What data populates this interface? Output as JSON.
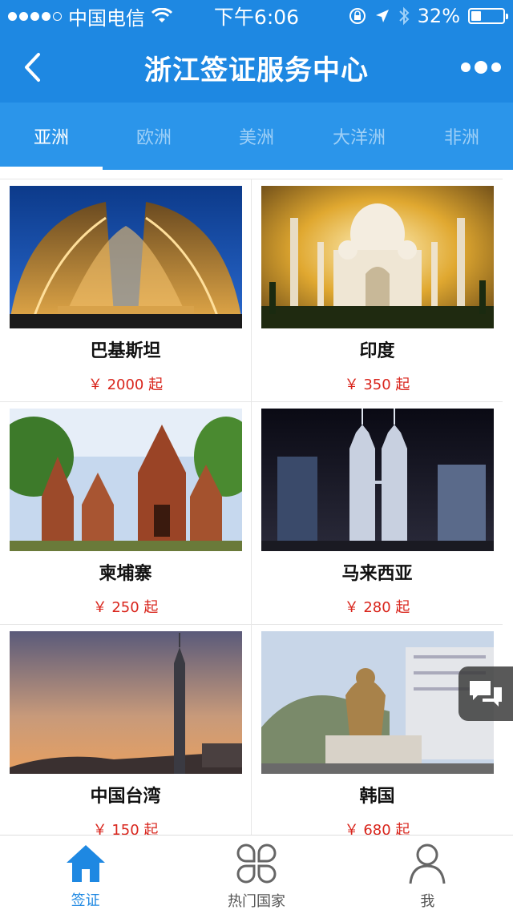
{
  "status": {
    "carrier": "中国电信",
    "time": "下午6:06",
    "battery": "32%",
    "battery_level": 0.32
  },
  "nav": {
    "title": "浙江签证服务中心",
    "back_icon": "chevron-left-icon",
    "more_icon": "more-dots-icon"
  },
  "tabs": [
    {
      "label": "亚洲",
      "active": true
    },
    {
      "label": "欧洲",
      "active": false
    },
    {
      "label": "美洲",
      "active": false
    },
    {
      "label": "大洋洲",
      "active": false
    },
    {
      "label": "非洲",
      "active": false
    }
  ],
  "countries": [
    {
      "name": "巴基斯坦",
      "price": "￥ 2000 起",
      "image": "pakistan-monument-image"
    },
    {
      "name": "印度",
      "price": "￥ 350 起",
      "image": "taj-mahal-image"
    },
    {
      "name": "柬埔寨",
      "price": "￥ 250 起",
      "image": "angkor-temple-image"
    },
    {
      "name": "马来西亚",
      "price": "￥ 280 起",
      "image": "petronas-towers-image"
    },
    {
      "name": "中国台湾",
      "price": "￥ 150 起",
      "image": "taipei-101-image"
    },
    {
      "name": "韩国",
      "price": "￥ 680 起",
      "image": "sejong-statue-image"
    }
  ],
  "tabbar": [
    {
      "label": "签证",
      "icon": "home-icon",
      "active": true
    },
    {
      "label": "热门国家",
      "icon": "clover-icon",
      "active": false
    },
    {
      "label": "我",
      "icon": "user-icon",
      "active": false
    }
  ],
  "colors": {
    "brand": "#1e88e2",
    "price": "#d9251c"
  }
}
